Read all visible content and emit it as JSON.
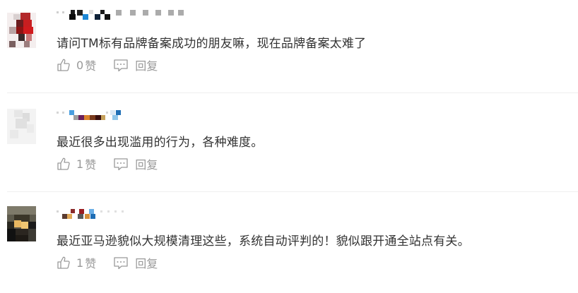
{
  "comments": [
    {
      "text": "请问TM标有品牌备案成功的朋友嘛，现在品牌备案太难了",
      "likes": "0",
      "like_label": "赞",
      "reply_label": "回复"
    },
    {
      "text": "最近很多出现滥用的行为，各种难度。",
      "likes": "1",
      "like_label": "赞",
      "reply_label": "回复"
    },
    {
      "text": "最近亚马逊貌似大规模清理这些，系统自动评判的！貌似跟开通全站点有关。",
      "likes": "1",
      "like_label": "赞",
      "reply_label": "回复"
    }
  ],
  "icons": {
    "like": "thumbs-up-icon",
    "reply": "comment-bubble-icon"
  },
  "colors": {
    "text": "#333333",
    "muted": "#999999",
    "divider": "#efefef"
  }
}
